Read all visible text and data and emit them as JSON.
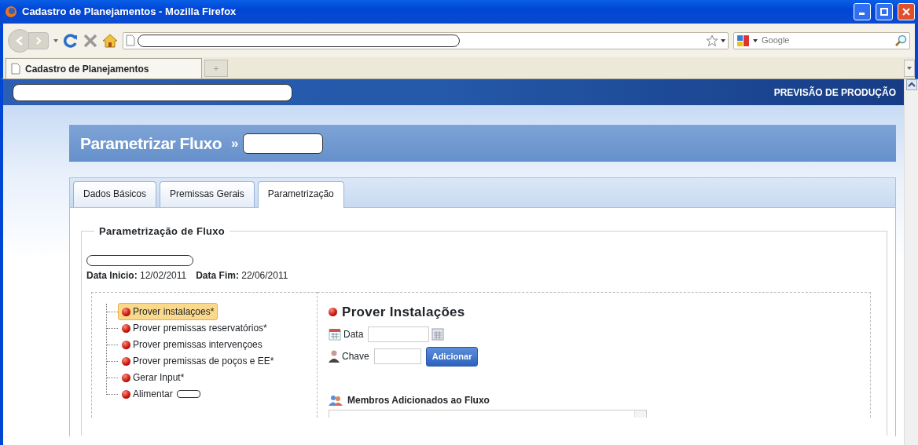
{
  "window": {
    "title": "Cadastro de Planejamentos - Mozilla Firefox"
  },
  "browser": {
    "search_placeholder": "Google",
    "tabs": [
      {
        "label": "Cadastro de Planejamentos",
        "selected": true
      }
    ],
    "new_tab": "+"
  },
  "page": {
    "banner": "PREVISÃO DE PRODUÇÃO",
    "heading": "Parametrizar Fluxo",
    "heading_separator": "»",
    "tabs": [
      {
        "label": "Dados Básicos",
        "selected": false
      },
      {
        "label": "Premissas Gerais",
        "selected": false
      },
      {
        "label": "Parametrização",
        "selected": true
      }
    ],
    "legend": "Parametrização de Fluxo",
    "dates": [
      {
        "label": "Data Inicio:",
        "value": "12/02/2011"
      },
      {
        "label": "Data Fim:",
        "value": "22/06/2011"
      }
    ],
    "tree": [
      {
        "label": "Prover instalaçoes*",
        "selected": true
      },
      {
        "label": "Prover premissas reservatórios*",
        "selected": false
      },
      {
        "label": "Prover premissas intervençoes",
        "selected": false
      },
      {
        "label": "Prover premissas de poços e EE*",
        "selected": false
      },
      {
        "label": "Gerar Input*",
        "selected": false
      },
      {
        "label": "Alimentar",
        "selected": false
      }
    ],
    "detail": {
      "title": "Prover Instalações",
      "date_label": "Data",
      "key_label": "Chave",
      "add_button": "Adicionar",
      "members_title": "Membros Adicionados ao Fluxo"
    }
  }
}
